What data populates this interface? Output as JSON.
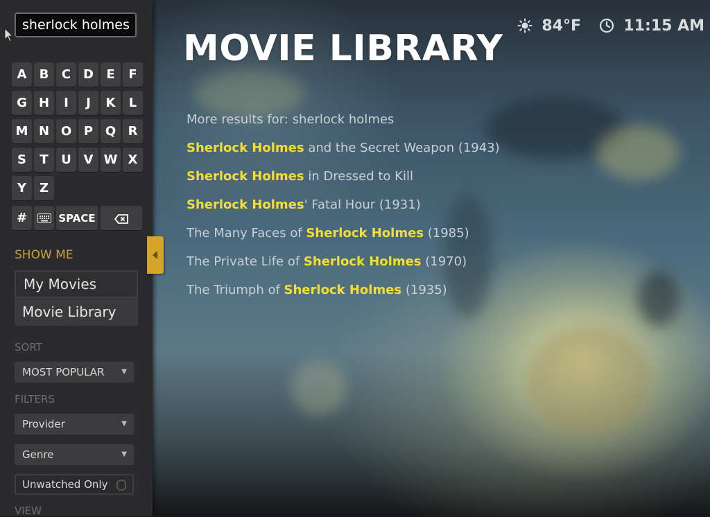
{
  "search": {
    "query": "sherlock holmes"
  },
  "keyboard": {
    "rows": [
      [
        "A",
        "B",
        "C",
        "D",
        "E",
        "F"
      ],
      [
        "G",
        "H",
        "I",
        "J",
        "K",
        "L"
      ],
      [
        "M",
        "N",
        "O",
        "P",
        "Q",
        "R"
      ],
      [
        "S",
        "T",
        "U",
        "V",
        "W",
        "X"
      ],
      [
        "Y",
        "Z"
      ]
    ],
    "special": {
      "hash": "#",
      "space": "SPACE"
    }
  },
  "show_me": {
    "label": "SHOW ME",
    "items": [
      {
        "label": "My Movies"
      },
      {
        "label": "Movie Library"
      }
    ]
  },
  "sort": {
    "label": "SORT",
    "value": "MOST POPULAR"
  },
  "filters": {
    "label": "FILTERS",
    "provider": "Provider",
    "genre": "Genre",
    "unwatched": "Unwatched Only"
  },
  "view": {
    "label": "VIEW"
  },
  "header": {
    "title": "MOVIE LIBRARY",
    "weather": "84°F",
    "time": "11:15 AM"
  },
  "results": {
    "more_label": "More results for: sherlock holmes",
    "items": [
      {
        "pre": "",
        "hl": "Sherlock Holmes",
        "post": " and the Secret Weapon (1943)"
      },
      {
        "pre": "",
        "hl": "Sherlock Holmes",
        "post": " in Dressed to Kill"
      },
      {
        "pre": "",
        "hl": "Sherlock Holmes",
        "post": "' Fatal Hour (1931)"
      },
      {
        "pre": "The Many Faces of ",
        "hl": "Sherlock Holmes",
        "post": " (1985)"
      },
      {
        "pre": "The Private Life of ",
        "hl": "Sherlock Holmes",
        "post": " (1970)"
      },
      {
        "pre": "The Triumph of ",
        "hl": "Sherlock Holmes",
        "post": " (1935)"
      }
    ]
  },
  "colors": {
    "accent": "#f3df34",
    "section_accent": "#c9a040",
    "tab_handle": "#d4a52a"
  },
  "icons": [
    "cursor-icon",
    "keyboard-icon",
    "backspace-icon",
    "sun-icon",
    "clock-icon",
    "chevron-down-icon",
    "chevron-left-icon"
  ]
}
